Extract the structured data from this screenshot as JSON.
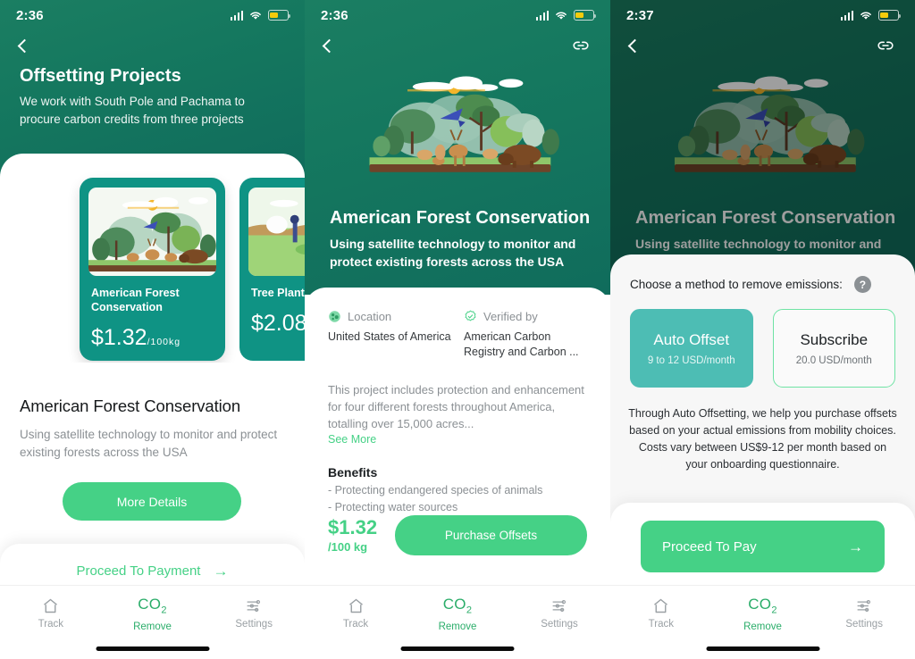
{
  "theme": {
    "header_green_top": "#1b7e62",
    "header_green_bottom": "#106c5c",
    "card_teal": "#0f9384",
    "accent_green": "#45d186",
    "tab_active_green": "#2bad6a",
    "muted_gray": "#8b9094",
    "select_teal": "#4dbdb4",
    "battery_yellow": "#f5cb0c"
  },
  "screen1": {
    "status": {
      "time": "2:36",
      "signal_icon": "cellular-bars-icon",
      "wifi_icon": "wifi-icon",
      "battery_icon": "battery-icon"
    },
    "nav": {
      "back_icon": "chevron-left-icon"
    },
    "header": {
      "title": "Offsetting Projects",
      "subtitle": "We work with South Pole and Pachama to procure carbon credits from three projects"
    },
    "cards": [
      {
        "name": "American Forest Conservation",
        "price": "$1.32",
        "unit": "/100kg",
        "image_icon": "forest-illustration"
      },
      {
        "name": "Tree Planting Panama",
        "price": "$2.08",
        "unit": "",
        "image_icon": "tree-planting-illustration"
      }
    ],
    "detail": {
      "title": "American Forest Conservation",
      "description": "Using satellite technology to monitor and protect existing forests across the USA",
      "more_details_label": "More Details"
    },
    "proceed": {
      "label": "Proceed To Payment",
      "arrow_icon": "arrow-right-icon"
    }
  },
  "screen2": {
    "status": {
      "time": "2:36"
    },
    "nav": {
      "back_icon": "chevron-left-icon",
      "link_icon": "link-icon"
    },
    "hero": {
      "image_icon": "forest-illustration"
    },
    "title": "American Forest Conservation",
    "subtitle": "Using satellite technology to monitor and protect existing forests across the USA",
    "meta": [
      {
        "icon": "globe-icon",
        "label": "Location",
        "value": "United States of America"
      },
      {
        "icon": "verified-badge-icon",
        "label": "Verified by",
        "value": "American Carbon Registry and Carbon ..."
      }
    ],
    "long_description": "This project includes protection and enhancement for four different forests throughout America, totalling over 15,000 acres...",
    "see_more_label": "See More",
    "benefits_title": "Benefits",
    "benefits": [
      "- Protecting endangered species of animals",
      "- Protecting water sources"
    ],
    "price": "$1.32",
    "price_unit": "/100 kg",
    "purchase_label": "Purchase Offsets"
  },
  "screen3": {
    "status": {
      "time": "2:37"
    },
    "nav": {
      "back_icon": "chevron-left-icon",
      "link_icon": "link-icon"
    },
    "title": "American Forest Conservation",
    "subtitle": "Using satellite technology to monitor and",
    "modal": {
      "question": "Choose a method to remove emissions:",
      "help_icon": "question-mark-icon",
      "options": [
        {
          "title": "Auto Offset",
          "sub": "9 to 12 USD/month",
          "selected": true
        },
        {
          "title": "Subscribe",
          "sub": "20.0 USD/month",
          "selected": false
        }
      ],
      "note": "Through Auto Offsetting, we help you purchase offsets based on your actual emissions from mobility choices. Costs vary between US$9-12 per month based on your onboarding questionnaire.",
      "pay_label": "Proceed To Pay",
      "pay_arrow_icon": "arrow-right-icon"
    }
  },
  "tabbar": {
    "items": [
      {
        "label": "Track",
        "icon": "home-icon",
        "active": false
      },
      {
        "label": "Remove",
        "icon": "co2-icon",
        "glyph": "CO",
        "sub": "2",
        "active": true
      },
      {
        "label": "Settings",
        "icon": "sliders-icon",
        "active": false
      }
    ]
  }
}
